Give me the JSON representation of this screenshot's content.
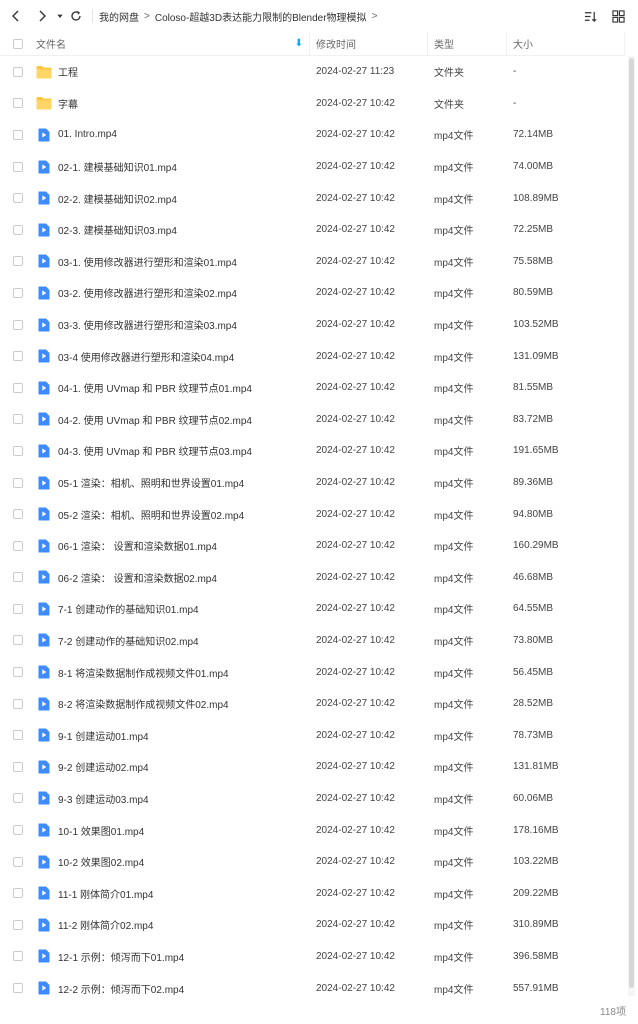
{
  "breadcrumb": [
    "我的网盘",
    "Coloso-超越3D表达能力限制的Blender物理模拟"
  ],
  "columns": {
    "name": "文件名",
    "time": "修改时间",
    "type": "类型",
    "size": "大小"
  },
  "colors": {
    "accent": "#06a7ff",
    "folder": "#ffc53d",
    "video": "#3d8bfd"
  },
  "files": [
    {
      "icon": "folder-icon",
      "name": "工程",
      "time": "2024-02-27 11:23",
      "type": "文件夹",
      "size": "-"
    },
    {
      "icon": "folder-icon",
      "name": "字幕",
      "time": "2024-02-27 10:42",
      "type": "文件夹",
      "size": "-"
    },
    {
      "icon": "video-file-icon",
      "name": "01. Intro.mp4",
      "time": "2024-02-27 10:42",
      "type": "mp4文件",
      "size": "72.14MB"
    },
    {
      "icon": "video-file-icon",
      "name": "02-1. 建模基础知识01.mp4",
      "time": "2024-02-27 10:42",
      "type": "mp4文件",
      "size": "74.00MB"
    },
    {
      "icon": "video-file-icon",
      "name": "02-2. 建模基础知识02.mp4",
      "time": "2024-02-27 10:42",
      "type": "mp4文件",
      "size": "108.89MB"
    },
    {
      "icon": "video-file-icon",
      "name": "02-3. 建模基础知识03.mp4",
      "time": "2024-02-27 10:42",
      "type": "mp4文件",
      "size": "72.25MB"
    },
    {
      "icon": "video-file-icon",
      "name": "03-1. 使用修改器进行塑形和渲染01.mp4",
      "time": "2024-02-27 10:42",
      "type": "mp4文件",
      "size": "75.58MB"
    },
    {
      "icon": "video-file-icon",
      "name": "03-2. 使用修改器进行塑形和渲染02.mp4",
      "time": "2024-02-27 10:42",
      "type": "mp4文件",
      "size": "80.59MB"
    },
    {
      "icon": "video-file-icon",
      "name": "03-3. 使用修改器进行塑形和渲染03.mp4",
      "time": "2024-02-27 10:42",
      "type": "mp4文件",
      "size": "103.52MB"
    },
    {
      "icon": "video-file-icon",
      "name": "03-4 使用修改器进行塑形和渲染04.mp4",
      "time": "2024-02-27 10:42",
      "type": "mp4文件",
      "size": "131.09MB"
    },
    {
      "icon": "video-file-icon",
      "name": "04-1. 使用 UVmap 和 PBR 纹理节点01.mp4",
      "time": "2024-02-27 10:42",
      "type": "mp4文件",
      "size": "81.55MB"
    },
    {
      "icon": "video-file-icon",
      "name": "04-2. 使用 UVmap 和 PBR 纹理节点02.mp4",
      "time": "2024-02-27 10:42",
      "type": "mp4文件",
      "size": "83.72MB"
    },
    {
      "icon": "video-file-icon",
      "name": "04-3. 使用 UVmap 和 PBR 纹理节点03.mp4",
      "time": "2024-02-27 10:42",
      "type": "mp4文件",
      "size": "191.65MB"
    },
    {
      "icon": "video-file-icon",
      "name": "05-1 渲染：相机、照明和世界设置01.mp4",
      "time": "2024-02-27 10:42",
      "type": "mp4文件",
      "size": "89.36MB"
    },
    {
      "icon": "video-file-icon",
      "name": "05-2 渲染：相机、照明和世界设置02.mp4",
      "time": "2024-02-27 10:42",
      "type": "mp4文件",
      "size": "94.80MB"
    },
    {
      "icon": "video-file-icon",
      "name": "06-1 渲染： 设置和渲染数据01.mp4",
      "time": "2024-02-27 10:42",
      "type": "mp4文件",
      "size": "160.29MB"
    },
    {
      "icon": "video-file-icon",
      "name": "06-2 渲染： 设置和渲染数据02.mp4",
      "time": "2024-02-27 10:42",
      "type": "mp4文件",
      "size": "46.68MB"
    },
    {
      "icon": "video-file-icon",
      "name": "7-1 创建动作的基础知识01.mp4",
      "time": "2024-02-27 10:42",
      "type": "mp4文件",
      "size": "64.55MB"
    },
    {
      "icon": "video-file-icon",
      "name": "7-2 创建动作的基础知识02.mp4",
      "time": "2024-02-27 10:42",
      "type": "mp4文件",
      "size": "73.80MB"
    },
    {
      "icon": "video-file-icon",
      "name": "8-1 将渲染数据制作成视频文件01.mp4",
      "time": "2024-02-27 10:42",
      "type": "mp4文件",
      "size": "56.45MB"
    },
    {
      "icon": "video-file-icon",
      "name": "8-2 将渲染数据制作成视频文件02.mp4",
      "time": "2024-02-27 10:42",
      "type": "mp4文件",
      "size": "28.52MB"
    },
    {
      "icon": "video-file-icon",
      "name": "9-1 创建运动01.mp4",
      "time": "2024-02-27 10:42",
      "type": "mp4文件",
      "size": "78.73MB"
    },
    {
      "icon": "video-file-icon",
      "name": "9-2 创建运动02.mp4",
      "time": "2024-02-27 10:42",
      "type": "mp4文件",
      "size": "131.81MB"
    },
    {
      "icon": "video-file-icon",
      "name": "9-3 创建运动03.mp4",
      "time": "2024-02-27 10:42",
      "type": "mp4文件",
      "size": "60.06MB"
    },
    {
      "icon": "video-file-icon",
      "name": "10-1 效果图01.mp4",
      "time": "2024-02-27 10:42",
      "type": "mp4文件",
      "size": "178.16MB"
    },
    {
      "icon": "video-file-icon",
      "name": "10-2 效果图02.mp4",
      "time": "2024-02-27 10:42",
      "type": "mp4文件",
      "size": "103.22MB"
    },
    {
      "icon": "video-file-icon",
      "name": "11-1 刚体简介01.mp4",
      "time": "2024-02-27 10:42",
      "type": "mp4文件",
      "size": "209.22MB"
    },
    {
      "icon": "video-file-icon",
      "name": "11-2 刚体简介02.mp4",
      "time": "2024-02-27 10:42",
      "type": "mp4文件",
      "size": "310.89MB"
    },
    {
      "icon": "video-file-icon",
      "name": "12-1 示例：倾泻而下01.mp4",
      "time": "2024-02-27 10:42",
      "type": "mp4文件",
      "size": "396.58MB"
    },
    {
      "icon": "video-file-icon",
      "name": "12-2 示例：倾泻而下02.mp4",
      "time": "2024-02-27 10:42",
      "type": "mp4文件",
      "size": "557.91MB"
    }
  ],
  "footer": {
    "count": "118项"
  }
}
